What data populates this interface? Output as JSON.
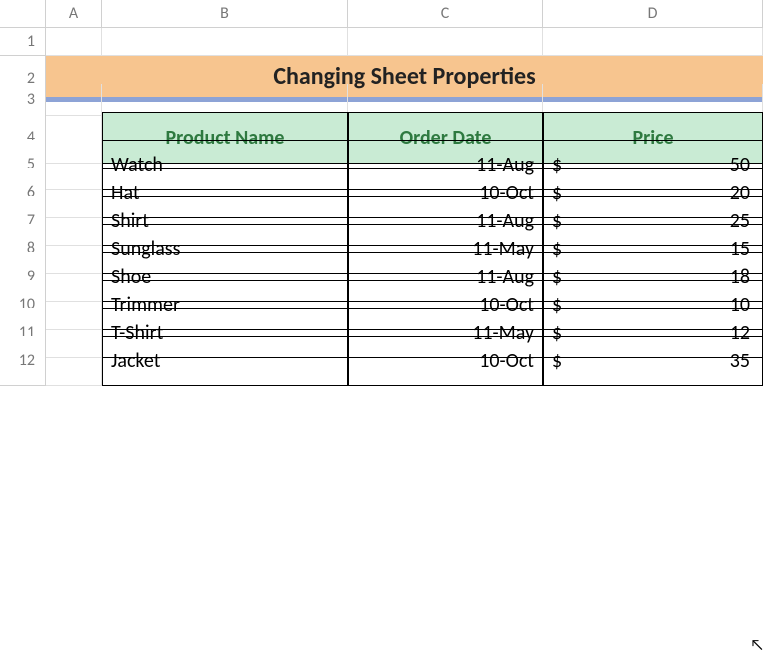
{
  "columns": [
    "A",
    "B",
    "C",
    "D"
  ],
  "rows": [
    "1",
    "2",
    "3",
    "4",
    "5",
    "6",
    "7",
    "8",
    "9",
    "10",
    "11",
    "12"
  ],
  "title": "Changing Sheet Properties",
  "table": {
    "headers": {
      "product": "Product Name",
      "date": "Order Date",
      "price": "Price"
    },
    "currency": "$",
    "rows": [
      {
        "product": "Watch",
        "date": "11-Aug",
        "price": "50"
      },
      {
        "product": "Hat",
        "date": "10-Oct",
        "price": "20"
      },
      {
        "product": "Shirt",
        "date": "11-Aug",
        "price": "25"
      },
      {
        "product": "Sunglass",
        "date": "11-May",
        "price": "15"
      },
      {
        "product": "Shoe",
        "date": "11-Aug",
        "price": "18"
      },
      {
        "product": "Trimmer",
        "date": "10-Oct",
        "price": "10"
      },
      {
        "product": "T-Shirt",
        "date": "11-May",
        "price": "12"
      },
      {
        "product": "Jacket",
        "date": "10-Oct",
        "price": "35"
      }
    ]
  },
  "chart_data": {
    "type": "table",
    "title": "Changing Sheet Properties",
    "columns": [
      "Product Name",
      "Order Date",
      "Price"
    ],
    "rows": [
      [
        "Watch",
        "11-Aug",
        50
      ],
      [
        "Hat",
        "10-Oct",
        20
      ],
      [
        "Shirt",
        "11-Aug",
        25
      ],
      [
        "Sunglass",
        "11-May",
        15
      ],
      [
        "Shoe",
        "11-Aug",
        18
      ],
      [
        "Trimmer",
        "10-Oct",
        10
      ],
      [
        "T-Shirt",
        "11-May",
        12
      ],
      [
        "Jacket",
        "10-Oct",
        35
      ]
    ],
    "currency": "$"
  }
}
